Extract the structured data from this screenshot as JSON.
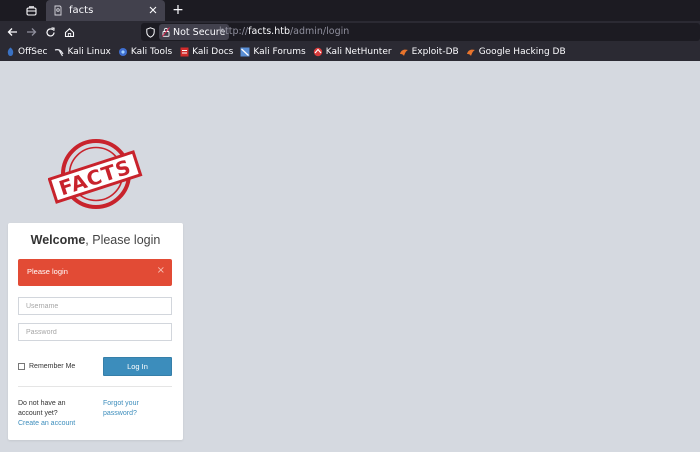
{
  "browser": {
    "tab": {
      "title": "facts"
    },
    "new_tab_label": "+",
    "url": {
      "security_label": "Not Secure",
      "scheme": "http://",
      "host": "facts.htb",
      "path": "/admin/login"
    },
    "bookmarks": [
      {
        "label": "OffSec",
        "icon": "offsec-icon"
      },
      {
        "label": "Kali Linux",
        "icon": "kali-linux-icon"
      },
      {
        "label": "Kali Tools",
        "icon": "kali-tools-icon"
      },
      {
        "label": "Kali Docs",
        "icon": "kali-docs-icon"
      },
      {
        "label": "Kali Forums",
        "icon": "kali-forums-icon"
      },
      {
        "label": "Kali NetHunter",
        "icon": "kali-nethunter-icon"
      },
      {
        "label": "Exploit-DB",
        "icon": "exploit-db-icon"
      },
      {
        "label": "Google Hacking DB",
        "icon": "ghdb-icon"
      }
    ]
  },
  "page": {
    "logo_text": "FACTS",
    "logo_color": "#c8232c",
    "background": "#d5d9e0"
  },
  "login": {
    "title_bold": "Welcome",
    "title_rest": ", Please login",
    "alert": {
      "text": "Please login",
      "close": "×",
      "color": "#e24b35"
    },
    "username_placeholder": "Username",
    "password_placeholder": "Password",
    "remember_label": "Remember Me",
    "login_button": "Log In",
    "button_color": "#3c8dbc",
    "no_account_text": "Do not have an account yet?",
    "create_account_link": "Create an account",
    "forgot_password_link": "Forgot your password?"
  }
}
